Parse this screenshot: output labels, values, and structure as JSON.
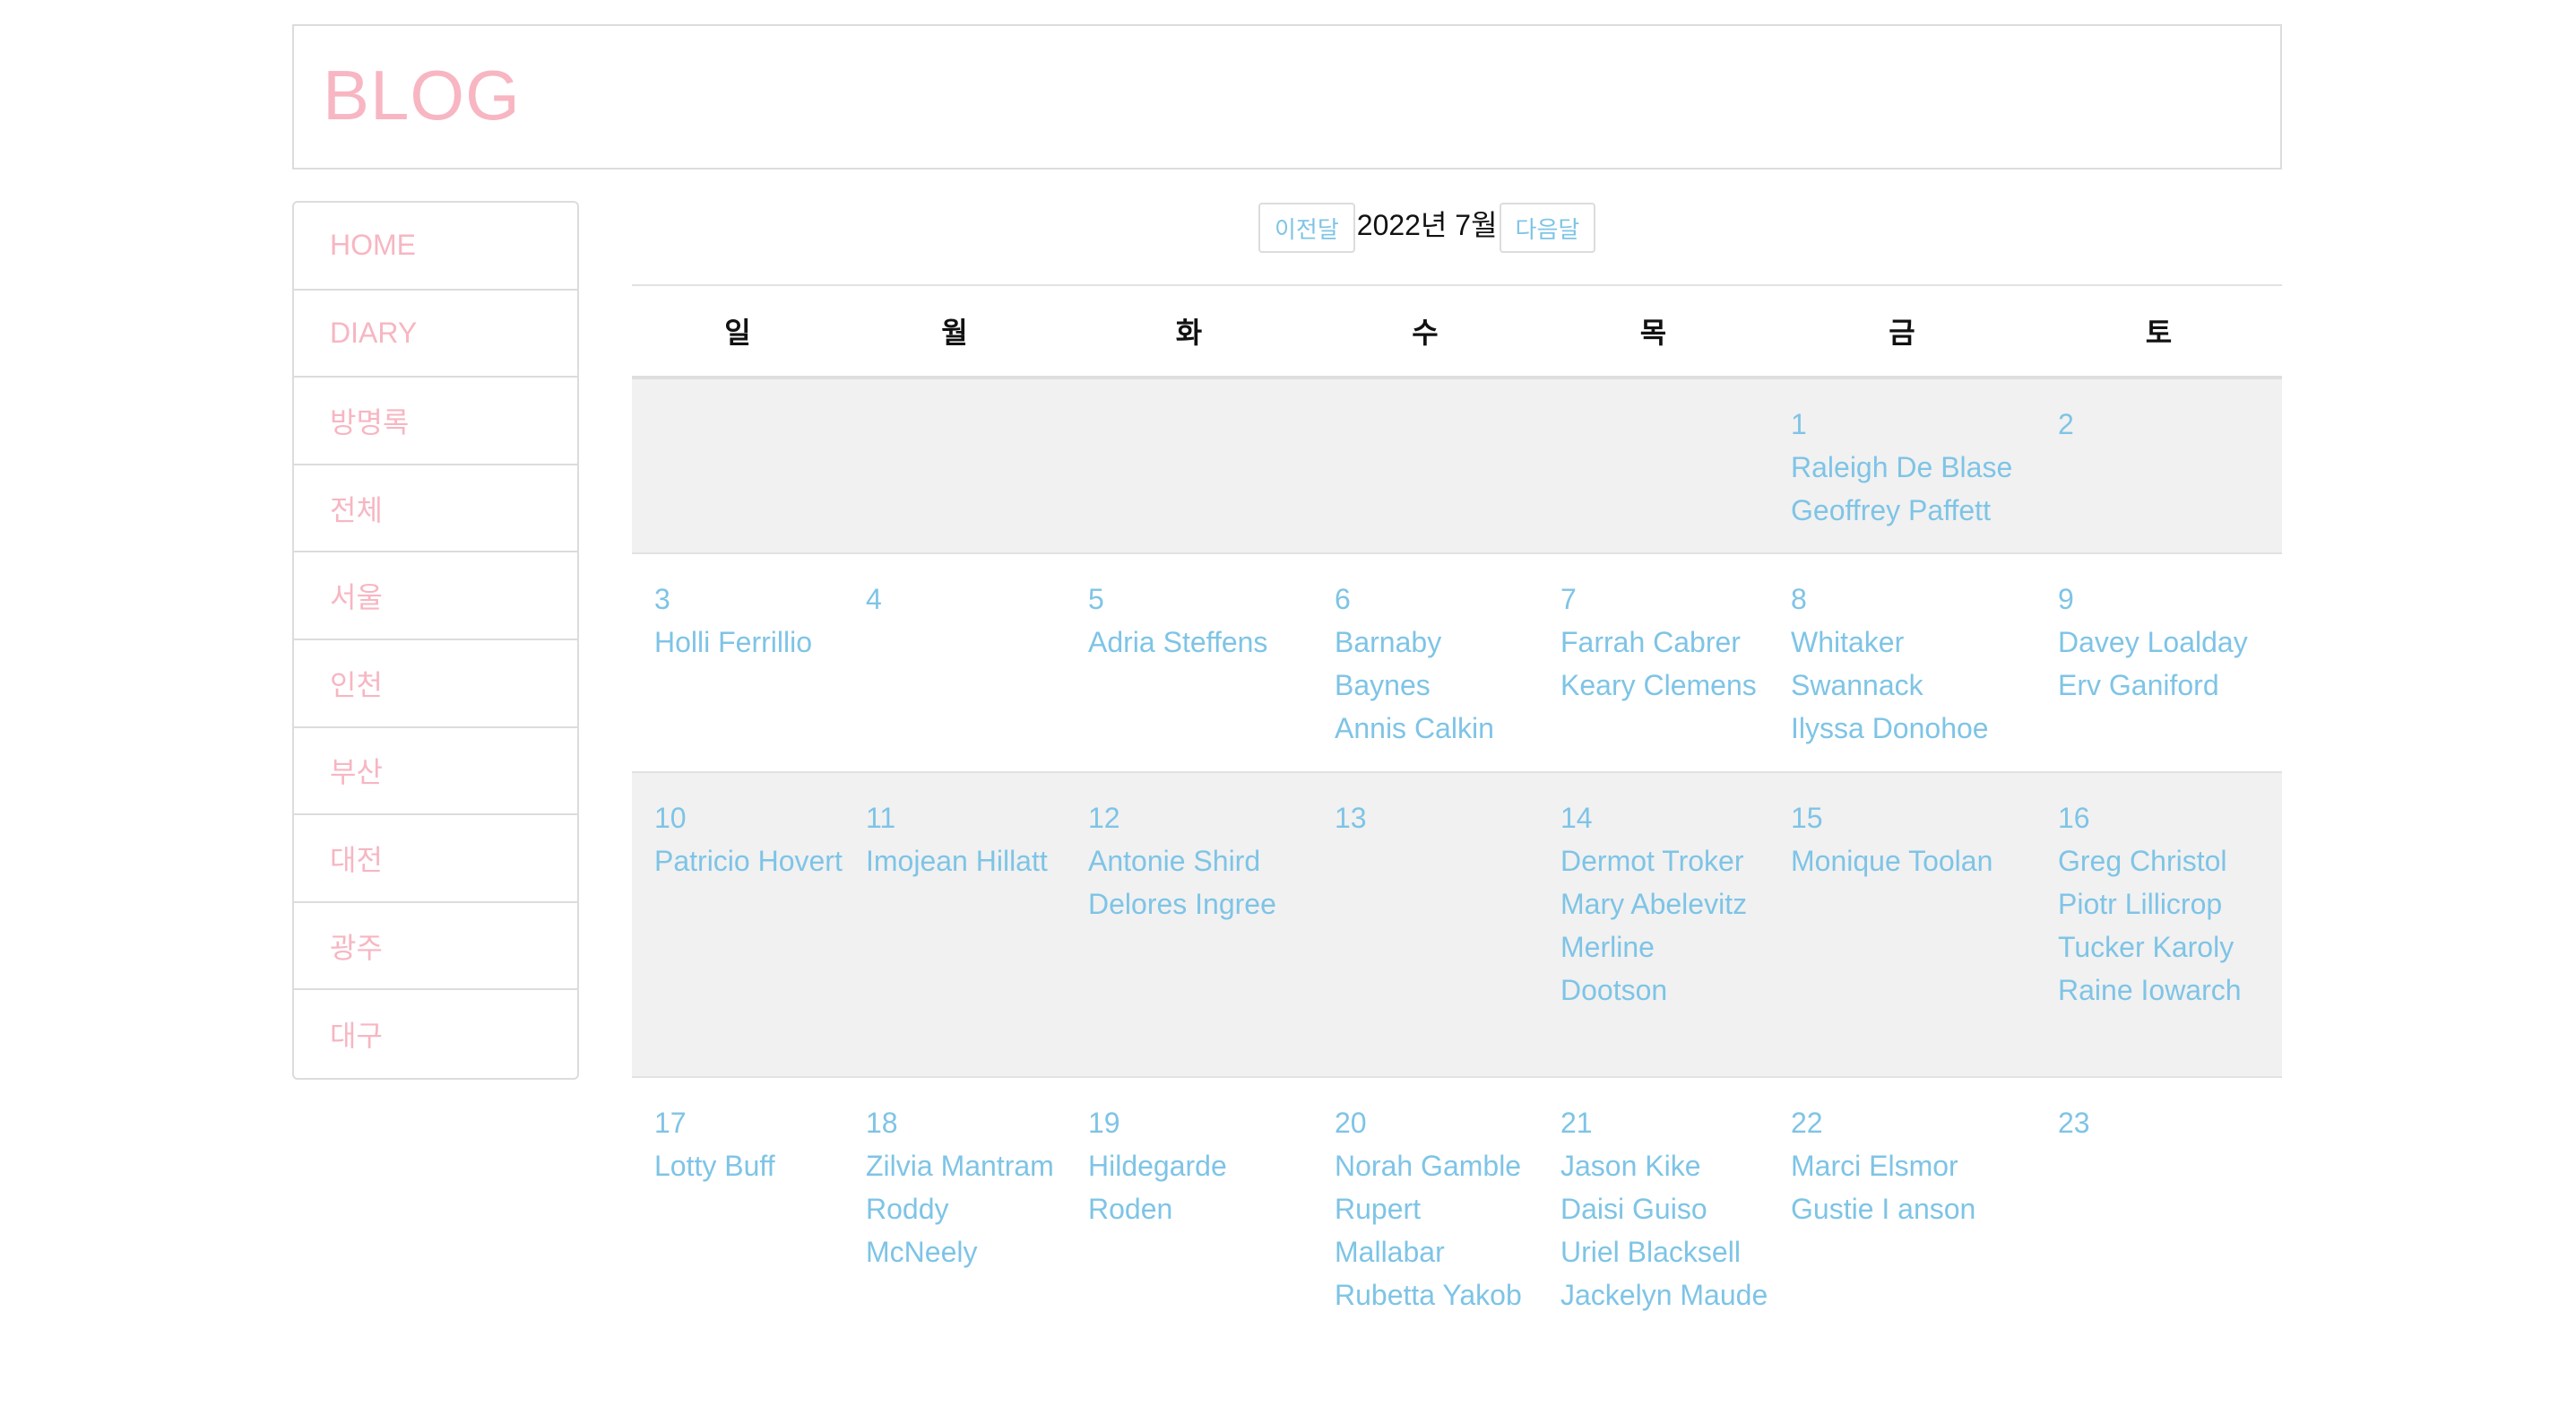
{
  "header": {
    "title": "BLOG"
  },
  "sidebar": {
    "items": [
      {
        "label": "HOME"
      },
      {
        "label": "DIARY"
      },
      {
        "label": "방명록"
      },
      {
        "label": "전체"
      },
      {
        "label": "서울"
      },
      {
        "label": "인천"
      },
      {
        "label": "부산"
      },
      {
        "label": "대전"
      },
      {
        "label": "광주"
      },
      {
        "label": "대구"
      }
    ]
  },
  "calendar": {
    "prev_label": "이전달",
    "month_label": "2022년 7월",
    "next_label": "다음달",
    "weekdays": [
      "일",
      "월",
      "화",
      "수",
      "목",
      "금",
      "토"
    ],
    "weeks": [
      [
        {
          "day": "",
          "events": []
        },
        {
          "day": "",
          "events": []
        },
        {
          "day": "",
          "events": []
        },
        {
          "day": "",
          "events": []
        },
        {
          "day": "",
          "events": []
        },
        {
          "day": "1",
          "events": [
            "Raleigh De Blase",
            "Geoffrey Paffett"
          ]
        },
        {
          "day": "2",
          "events": []
        }
      ],
      [
        {
          "day": "3",
          "events": [
            "Holli Ferrillio"
          ]
        },
        {
          "day": "4",
          "events": []
        },
        {
          "day": "5",
          "events": [
            "Adria Steffens"
          ]
        },
        {
          "day": "6",
          "events": [
            "Barnaby Baynes",
            "Annis Calkin"
          ]
        },
        {
          "day": "7",
          "events": [
            "Farrah Cabrer",
            "Keary Clemens"
          ]
        },
        {
          "day": "8",
          "events": [
            "Whitaker Swannack",
            "Ilyssa Donohoe"
          ]
        },
        {
          "day": "9",
          "events": [
            "Davey Loalday",
            "Erv Ganiford"
          ]
        }
      ],
      [
        {
          "day": "10",
          "events": [
            "Patricio Hovert"
          ]
        },
        {
          "day": "11",
          "events": [
            "Imojean Hillatt"
          ]
        },
        {
          "day": "12",
          "events": [
            "Antonie Shird",
            "Delores Ingree"
          ]
        },
        {
          "day": "13",
          "events": []
        },
        {
          "day": "14",
          "events": [
            "Dermot Troker",
            "Mary Abelevitz",
            "Merline Dootson"
          ]
        },
        {
          "day": "15",
          "events": [
            "Monique Toolan"
          ]
        },
        {
          "day": "16",
          "events": [
            "Greg Christol",
            "Piotr Lillicrop",
            "Tucker Karoly",
            "Raine Iowarch"
          ]
        }
      ],
      [
        {
          "day": "17",
          "events": [
            "Lotty Buff"
          ]
        },
        {
          "day": "18",
          "events": [
            "Zilvia Mantram",
            "Roddy McNeely"
          ]
        },
        {
          "day": "19",
          "events": [
            "Hildegarde Roden"
          ]
        },
        {
          "day": "20",
          "events": [
            "Norah Gamble",
            "Rupert Mallabar",
            "Rubetta Yakob"
          ]
        },
        {
          "day": "21",
          "events": [
            "Jason Kike",
            "Daisi Guiso",
            "Uriel Blacksell",
            "Jackelyn Maude"
          ]
        },
        {
          "day": "22",
          "events": [
            "Marci Elsmor",
            "Gustie I anson"
          ]
        },
        {
          "day": "23",
          "events": []
        }
      ]
    ]
  },
  "colors": {
    "brand_pink": "#f7b6c2",
    "link_blue": "#7ec4e6",
    "row_shade": "#f1f1f1",
    "border": "#dcdcdc"
  }
}
